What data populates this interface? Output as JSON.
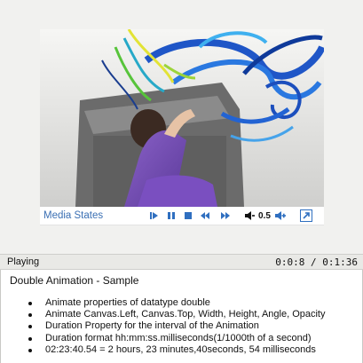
{
  "player": {
    "media_states_label": "Media States",
    "volume_value": "0.5"
  },
  "status": {
    "state": "Playing",
    "time": "0:0:8 / 0:1:36"
  },
  "description": {
    "title": "Double Animation - Sample",
    "items": [
      "Animate properties of datatype double",
      "Animate Canvas.Left, Canvas.Top, Width, Height, Angle, Opacity",
      "Duration Property for the interval of the Animation",
      "Duration format hh:mm:ss.milliseconds(1/1000th of a second)",
      "02:23:40.54 = 2 hours, 23 minutes,40seconds, 54 milliseconds"
    ]
  },
  "icons": {
    "play": "play-icon",
    "pause": "pause-icon",
    "stop": "stop-icon",
    "rewind": "rewind-icon",
    "fast_forward": "fast-forward-icon",
    "volume_down": "volume-down-icon",
    "volume_up": "volume-up-icon",
    "fullscreen": "fullscreen-icon"
  },
  "colors": {
    "accent": "#3a6fb3",
    "icon_blue": "#2f6fc0",
    "status_bg": "#e9e9e6"
  }
}
